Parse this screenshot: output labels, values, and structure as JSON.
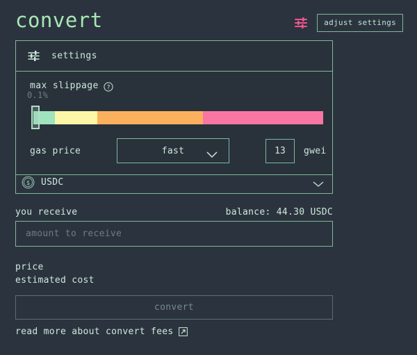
{
  "header": {
    "title": "convert",
    "sliders_icon": "sliders-icon",
    "adjust_settings_label": "adjust settings"
  },
  "settings_panel": {
    "head_icon": "sliders-icon",
    "head_label": "settings",
    "slippage": {
      "label": "max slippage",
      "help_icon": "question-mark-circle-icon",
      "value": "0.1%",
      "segments": [
        {
          "name": "low",
          "color": "#9fe3bf",
          "width_pct": 7.5
        },
        {
          "name": "medium-low",
          "color": "#fbf7a6",
          "width_pct": 14.5
        },
        {
          "name": "medium-high",
          "color": "#fbb05e",
          "width_pct": 36.5
        },
        {
          "name": "high",
          "color": "#fa76a2",
          "width_pct": 41.5
        }
      ],
      "thumb_position_pct": 0
    },
    "gas": {
      "label": "gas price",
      "speed_value": "fast",
      "speed_chevron": "chevron-down-icon",
      "amount": "13",
      "unit": "gwei"
    }
  },
  "token_row": {
    "icon": "dollar-circle-icon",
    "symbol": "USDC",
    "chevron": "chevron-down-icon"
  },
  "receive": {
    "title": "you receive",
    "balance": "balance: 44.30 USDC",
    "placeholder": "amount to receive",
    "value": ""
  },
  "info": [
    {
      "label": "price",
      "value": ""
    },
    {
      "label": "estimated cost",
      "value": ""
    }
  ],
  "convert_button": {
    "label": "convert"
  },
  "footer": {
    "link_text": "read more about convert fees",
    "icon": "external-link-icon"
  },
  "colors": {
    "background": "#2b343e",
    "panel_background": "#29323b",
    "border": "#7fb89c",
    "accent_title": "#a9e6b6",
    "text": "#cfe8dc",
    "muted_text": "#6e7d80",
    "pink_icon": "#f0558c",
    "disabled_border": "#5d6f73",
    "disabled_text": "#788a8d"
  }
}
